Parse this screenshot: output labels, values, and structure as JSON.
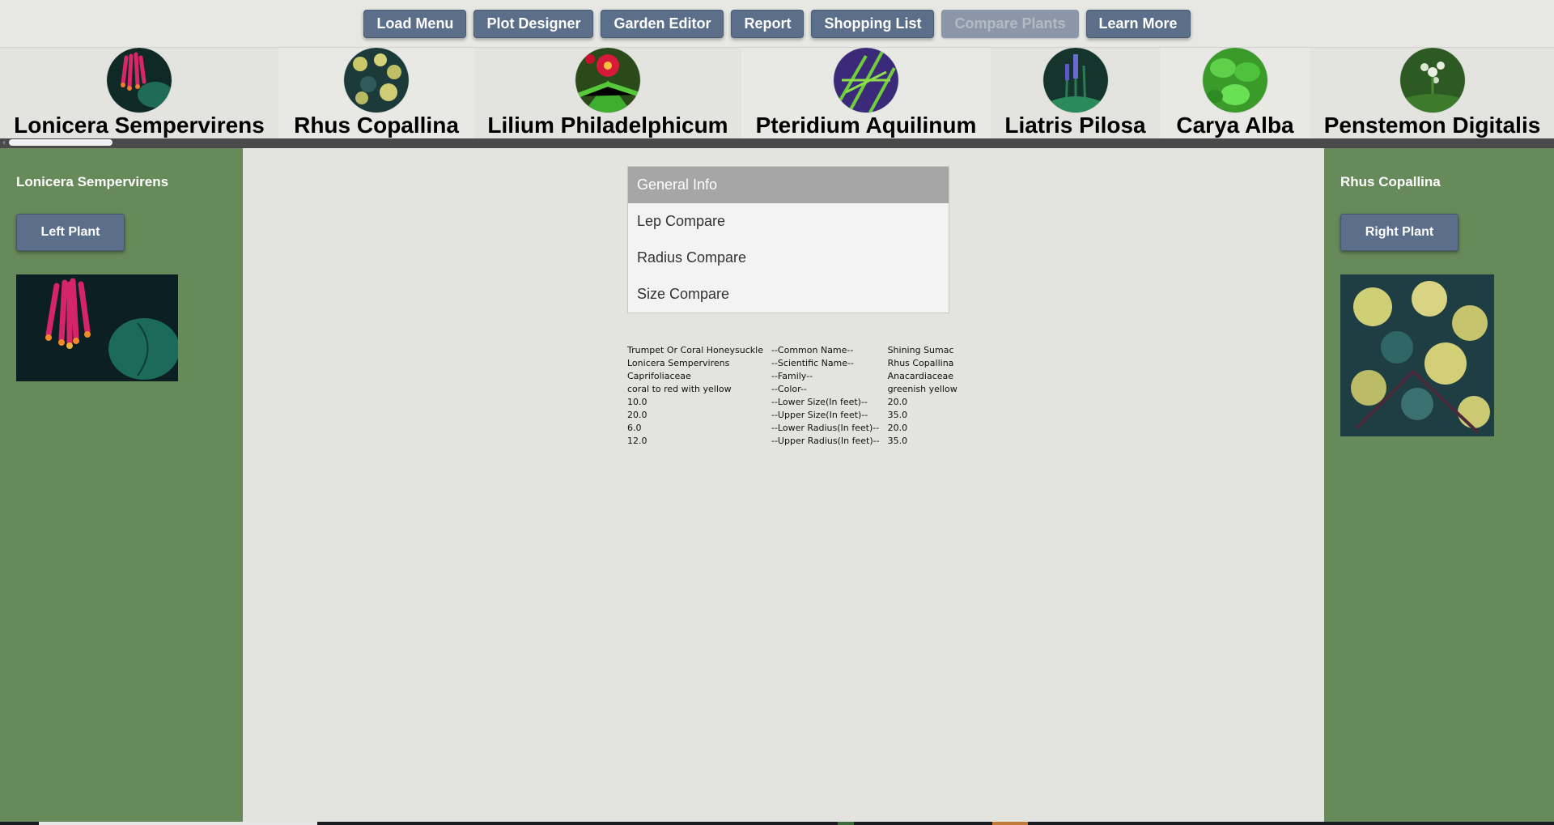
{
  "nav": {
    "buttons": [
      {
        "label": "Load Menu",
        "enabled": true
      },
      {
        "label": "Plot Designer",
        "enabled": true
      },
      {
        "label": "Garden Editor",
        "enabled": true
      },
      {
        "label": "Report",
        "enabled": true
      },
      {
        "label": "Shopping List",
        "enabled": true
      },
      {
        "label": "Compare Plants",
        "enabled": false
      },
      {
        "label": "Learn More",
        "enabled": true
      }
    ]
  },
  "plants": [
    {
      "name": "Lonicera Sempervirens"
    },
    {
      "name": "Rhus Copallina"
    },
    {
      "name": "Lilium Philadelphicum"
    },
    {
      "name": "Pteridium Aquilinum"
    },
    {
      "name": "Liatris Pilosa"
    },
    {
      "name": "Carya Alba"
    },
    {
      "name": "Penstemon Digitalis"
    }
  ],
  "left_panel": {
    "title": "Lonicera Sempervirens",
    "button_label": "Left Plant"
  },
  "right_panel": {
    "title": "Rhus Copallina",
    "button_label": "Right Plant"
  },
  "tabs": [
    {
      "label": "General Info",
      "active": true
    },
    {
      "label": "Lep Compare",
      "active": false
    },
    {
      "label": "Radius Compare",
      "active": false
    },
    {
      "label": "Size Compare",
      "active": false
    }
  ],
  "comparison": {
    "rows": [
      {
        "left": "Trumpet Or Coral Honeysuckle",
        "label": "--Common Name--",
        "right": "Shining Sumac"
      },
      {
        "left": "Lonicera Sempervirens",
        "label": "--Scientific Name--",
        "right": "Rhus Copallina"
      },
      {
        "left": "Caprifoliaceae",
        "label": "--Family--",
        "right": "Anacardiaceae"
      },
      {
        "left": "coral to red with yellow",
        "label": "--Color--",
        "right": "greenish yellow"
      },
      {
        "left": "10.0",
        "label": "--Lower Size(In feet)--",
        "right": "20.0"
      },
      {
        "left": "20.0",
        "label": "--Upper Size(In feet)--",
        "right": "35.0"
      },
      {
        "left": "6.0",
        "label": "--Lower Radius(In feet)--",
        "right": "20.0"
      },
      {
        "left": "12.0",
        "label": "--Upper Radius(In feet)--",
        "right": "35.0"
      }
    ]
  },
  "colors": {
    "panel_green": "#678a5b",
    "button_blue": "#5b6e8a",
    "active_tab": "#a6a6a6",
    "background": "#e3e4e0"
  }
}
